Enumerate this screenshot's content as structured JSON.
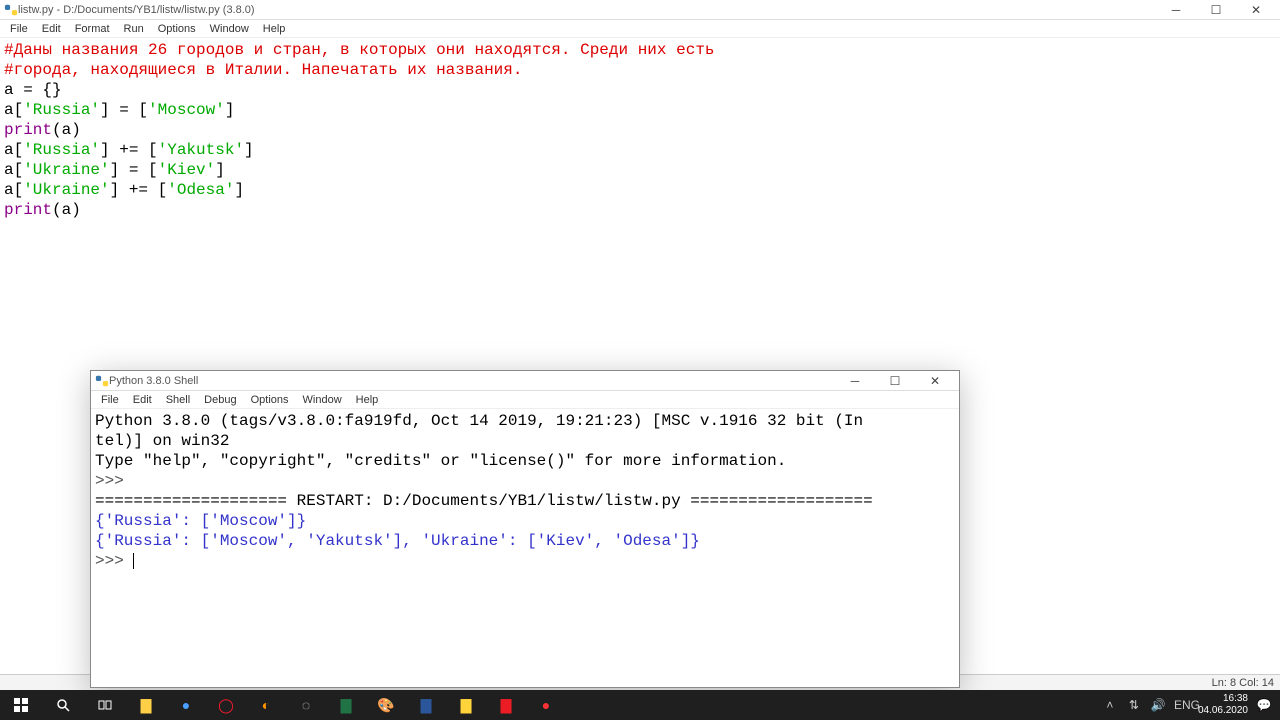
{
  "editor": {
    "title": "listw.py - D:/Documents/YB1/listw/listw.py (3.8.0)",
    "menus": [
      "File",
      "Edit",
      "Format",
      "Run",
      "Options",
      "Window",
      "Help"
    ],
    "code": {
      "comment1": "#Даны названия 26 городов и стран, в которых они находятся. Среди них есть",
      "comment2": "#города, находящиеся в Италии. Напечатать их названия.",
      "l3_a": "a = {}",
      "l4_a": "a[",
      "l4_s1": "'Russia'",
      "l4_b": "] = [",
      "l4_s2": "'Moscow'",
      "l4_c": "]",
      "l5_p": "print",
      "l5_b": "(a)",
      "l6_a": "a[",
      "l6_s1": "'Russia'",
      "l6_b": "] += [",
      "l6_s2": "'Yakutsk'",
      "l6_c": "]",
      "l7_a": "a[",
      "l7_s1": "'Ukraine'",
      "l7_b": "] = [",
      "l7_s2": "'Kiev'",
      "l7_c": "]",
      "l8_a": "a[",
      "l8_s1": "'Ukraine'",
      "l8_b": "] += [",
      "l8_s2": "'Odesa'",
      "l8_c": "]",
      "l9_p": "print",
      "l9_b": "(a)"
    },
    "status": "Ln: 8  Col: 14"
  },
  "shell": {
    "title": "Python 3.8.0 Shell",
    "menus": [
      "File",
      "Edit",
      "Shell",
      "Debug",
      "Options",
      "Window",
      "Help"
    ],
    "banner1": "Python 3.8.0 (tags/v3.8.0:fa919fd, Oct 14 2019, 19:21:23) [MSC v.1916 32 bit (In",
    "banner2": "tel)] on win32",
    "banner3": "Type \"help\", \"copyright\", \"credits\" or \"license()\" for more information.",
    "prompt": ">>> ",
    "restart": "==================== RESTART: D:/Documents/YB1/listw/listw.py ===================",
    "out1": "{'Russia': ['Moscow']}",
    "out2": "{'Russia': ['Moscow', 'Yakutsk'], 'Ukraine': ['Kiev', 'Odesa']}"
  },
  "taskbar": {
    "lang": "ENG",
    "time": "16:38",
    "date": "04.06.2020"
  }
}
